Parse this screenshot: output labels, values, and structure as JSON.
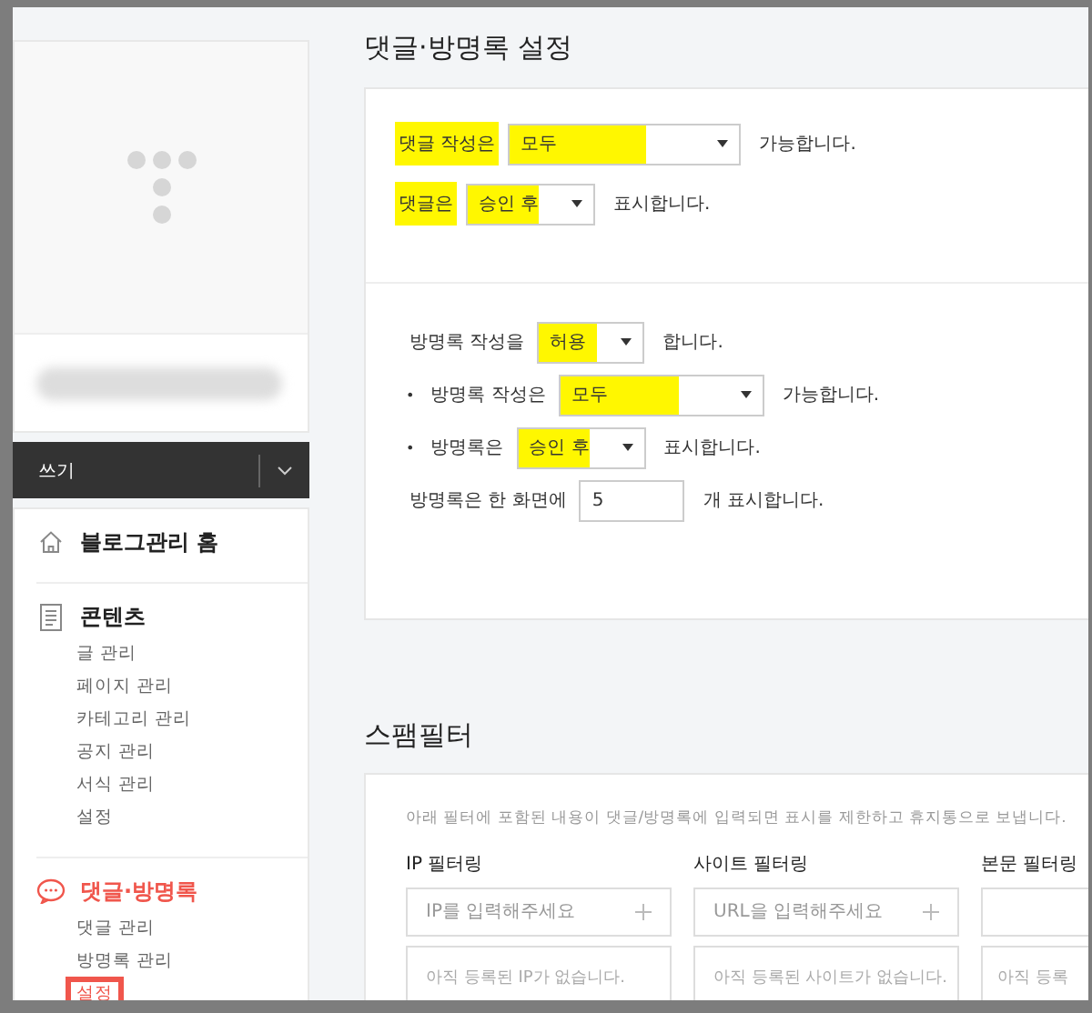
{
  "sidebar": {
    "write_button": {
      "label": "쓰기"
    },
    "menu": [
      {
        "kind": "home",
        "label": "블로그관리 홈",
        "selected": false
      },
      {
        "kind": "document",
        "label": "콘텐츠",
        "selected": false,
        "items": [
          {
            "label": "글 관리",
            "selected": false,
            "marked": false
          },
          {
            "label": "페이지 관리",
            "selected": false,
            "marked": false
          },
          {
            "label": "카테고리 관리",
            "selected": false,
            "marked": false
          },
          {
            "label": "공지 관리",
            "selected": false,
            "marked": false
          },
          {
            "label": "서식 관리",
            "selected": false,
            "marked": false
          },
          {
            "label": "설정",
            "selected": false,
            "marked": false
          }
        ]
      },
      {
        "kind": "comment",
        "label": "댓글·방명록",
        "selected": true,
        "items": [
          {
            "label": "댓글 관리",
            "selected": false,
            "marked": false
          },
          {
            "label": "방명록 관리",
            "selected": false,
            "marked": false
          },
          {
            "label": "설정",
            "selected": true,
            "marked": true
          }
        ]
      }
    ]
  },
  "settings": {
    "title": "댓글·방명록 설정",
    "groups": [
      [
        {
          "kind": "select",
          "label": "댓글 작성은",
          "label_highlighted": true,
          "value": "모두",
          "select_highlighted": true,
          "suffix": "가능합니다."
        },
        {
          "kind": "select",
          "label": "댓글은",
          "label_highlighted": true,
          "value": "승인 후",
          "select_highlighted": true,
          "suffix": "표시합니다."
        }
      ],
      [
        {
          "kind": "select",
          "label": "방명록 작성을",
          "label_highlighted": false,
          "value": "허용",
          "select_highlighted": true,
          "suffix": "합니다."
        },
        {
          "kind": "select",
          "bullet": "•",
          "label": "방명록 작성은",
          "label_highlighted": false,
          "value": "모두",
          "select_highlighted": true,
          "suffix": "가능합니다."
        },
        {
          "kind": "select",
          "bullet": "•",
          "label": "방명록은",
          "label_highlighted": false,
          "value": "승인 후",
          "select_highlighted": true,
          "suffix": "표시합니다."
        },
        {
          "kind": "input",
          "label": "방명록은 한 화면에",
          "label_highlighted": false,
          "value": "5",
          "suffix": "개 표시합니다."
        }
      ]
    ]
  },
  "spam_filter": {
    "title": "스팸필터",
    "description": "아래 필터에 포함된 내용이 댓글/방명록에 입력되면 표시를 제한하고 휴지통으로 보냅니다.",
    "columns": [
      {
        "heading": "IP 필터링",
        "placeholder": "IP를 입력해주세요",
        "empty_text": "아직 등록된 IP가 없습니다."
      },
      {
        "heading": "사이트 필터링",
        "placeholder": "URL을 입력해주세요",
        "empty_text": "아직 등록된 사이트가 없습니다."
      },
      {
        "heading": "본문 필터링",
        "empty_text": "아직 등록"
      }
    ]
  }
}
